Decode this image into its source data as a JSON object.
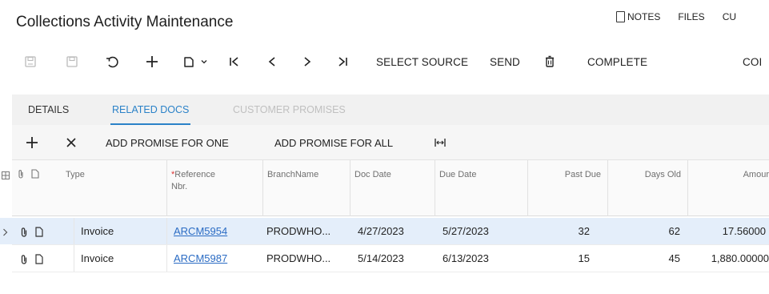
{
  "page": {
    "title": "Collections Activity Maintenance"
  },
  "top_actions": {
    "notes": "NOTES",
    "files": "FILES",
    "cu": "CU"
  },
  "toolbar": {
    "select_source": "SELECT SOURCE",
    "send": "SEND",
    "complete": "COMPLETE",
    "more": "COI"
  },
  "tabs": [
    {
      "label": "DETAILS",
      "active": false
    },
    {
      "label": "RELATED DOCS",
      "active": true
    },
    {
      "label": "CUSTOMER PROMISES",
      "active": false
    }
  ],
  "grid_toolbar": {
    "add_promise_one": "ADD PROMISE FOR ONE",
    "add_promise_all": "ADD PROMISE FOR ALL"
  },
  "columns": {
    "type": "Type",
    "ref_req": "*",
    "ref": "Reference",
    "ref2": "Nbr.",
    "branch": "BranchName",
    "doc_date": "Doc Date",
    "due_date": "Due Date",
    "past_due": "Past Due",
    "days_old": "Days Old",
    "amount": "Amour"
  },
  "rows": [
    {
      "type": "Invoice",
      "ref": "ARCM5954",
      "branch": "PRODWHO...",
      "doc_date": "4/27/2023",
      "due_date": "5/27/2023",
      "past_due": "32",
      "days_old": "62",
      "amount": "17.56000"
    },
    {
      "type": "Invoice",
      "ref": "ARCM5987",
      "branch": "PRODWHO...",
      "doc_date": "5/14/2023",
      "due_date": "6/13/2023",
      "past_due": "15",
      "days_old": "45",
      "amount": "1,880.00000"
    }
  ],
  "colors": {
    "accent": "#2b82c8",
    "link": "#2b6cc4",
    "selected_row": "#e4eefa"
  }
}
